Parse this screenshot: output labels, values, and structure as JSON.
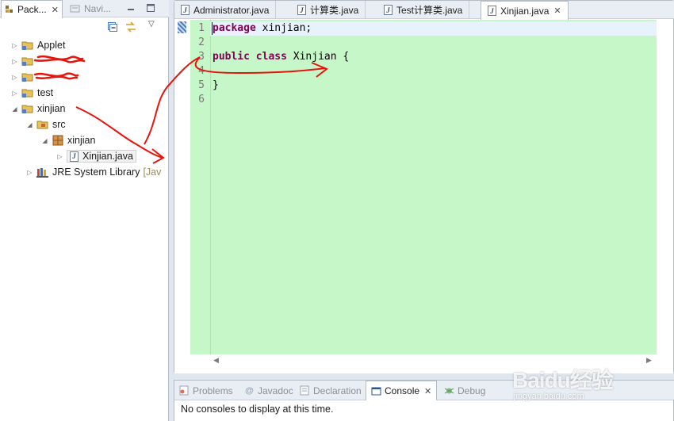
{
  "left_view": {
    "tabs": [
      {
        "label": "Pack...",
        "active": true
      },
      {
        "label": "Navi...",
        "active": false
      }
    ],
    "tree": [
      {
        "label": "Applet",
        "level": 0,
        "twisty": "collapsed",
        "icon": "project-folder-icon"
      },
      {
        "label": "",
        "level": 0,
        "twisty": "collapsed",
        "icon": "project-folder-icon",
        "redacted": true
      },
      {
        "label": "",
        "level": 0,
        "twisty": "collapsed",
        "icon": "project-folder-icon",
        "redacted": true
      },
      {
        "label": "test",
        "level": 0,
        "twisty": "collapsed",
        "icon": "project-folder-icon"
      },
      {
        "label": "xinjian",
        "level": 0,
        "twisty": "expanded",
        "icon": "project-folder-icon"
      },
      {
        "label": "src",
        "level": 1,
        "twisty": "expanded",
        "icon": "source-folder-icon"
      },
      {
        "label": "xinjian",
        "level": 2,
        "twisty": "expanded",
        "icon": "package-icon"
      },
      {
        "label": "Xinjian.java",
        "level": 3,
        "twisty": "collapsed",
        "icon": "java-file-icon",
        "selected": true
      },
      {
        "label": "JRE System Library",
        "suffix": "[Jav",
        "level": 1,
        "twisty": "collapsed",
        "icon": "library-icon"
      }
    ]
  },
  "editor": {
    "tabs": [
      {
        "label": "Administrator.java",
        "active": false
      },
      {
        "label": "计算类.java",
        "active": false
      },
      {
        "label": "Test计算类.java",
        "active": false
      },
      {
        "label": "Xinjian.java",
        "active": true,
        "close": "✕"
      }
    ],
    "lines": [
      {
        "num": "1",
        "parts": [
          {
            "t": "package",
            "kw": true
          },
          {
            "t": " xinjian;",
            "kw": false
          }
        ]
      },
      {
        "num": "2",
        "parts": []
      },
      {
        "num": "3",
        "parts": [
          {
            "t": "public",
            "kw": true
          },
          {
            "t": " ",
            "kw": false
          },
          {
            "t": "class",
            "kw": true
          },
          {
            "t": " Xinjian {",
            "kw": false
          }
        ]
      },
      {
        "num": "4",
        "parts": []
      },
      {
        "num": "5",
        "parts": [
          {
            "t": "}",
            "kw": false
          }
        ]
      },
      {
        "num": "6",
        "parts": []
      }
    ]
  },
  "bottom_view": {
    "tabs": [
      {
        "label": "Problems",
        "icon": "problems-icon",
        "active": false
      },
      {
        "label": "Javadoc",
        "icon": "javadoc-icon",
        "active": false
      },
      {
        "label": "Declaration",
        "icon": "declaration-icon",
        "active": false
      },
      {
        "label": "Console",
        "icon": "console-icon",
        "active": true,
        "close": "✕"
      },
      {
        "label": "Debug",
        "icon": "debug-icon",
        "active": false
      }
    ],
    "message": "No consoles to display at this time."
  },
  "watermark": {
    "brand": "Baidu经验",
    "site": "jingyan.baidu.com"
  },
  "colors": {
    "keyword": "#7f0055",
    "editor_bg": "#c6f7c9",
    "annotation": "#e8140c"
  }
}
